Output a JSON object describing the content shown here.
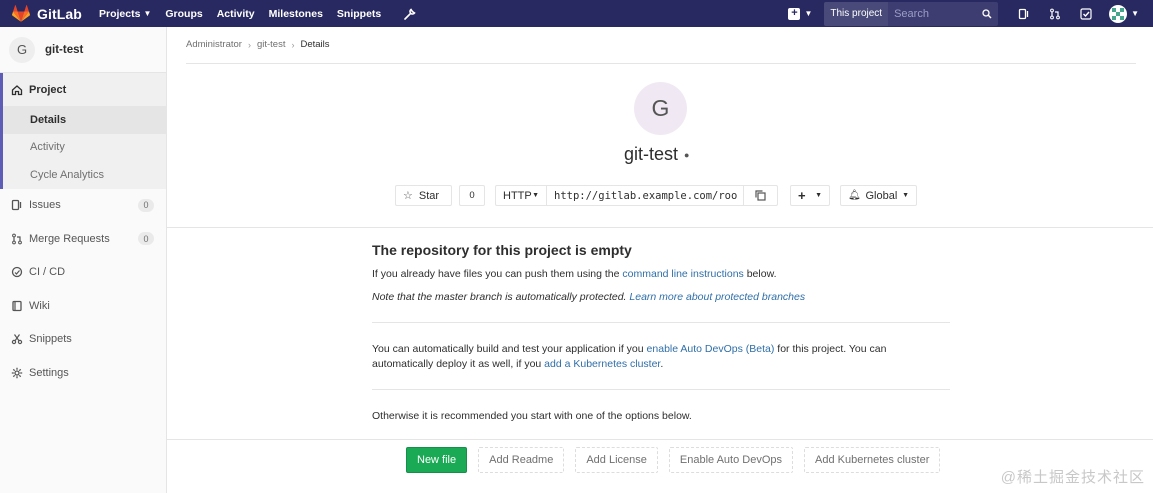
{
  "navbar": {
    "brand": "GitLab",
    "links": [
      {
        "label": "Projects",
        "dropdown": true
      },
      {
        "label": "Groups",
        "dropdown": false
      },
      {
        "label": "Activity",
        "dropdown": false
      },
      {
        "label": "Milestones",
        "dropdown": false
      },
      {
        "label": "Snippets",
        "dropdown": false
      }
    ],
    "search_scope": "This project",
    "search_placeholder": "Search",
    "bg_color": "#292961"
  },
  "sidebar": {
    "avatar_letter": "G",
    "project_name": "git-test",
    "project_label": "Project",
    "project_subitems": [
      {
        "label": "Details",
        "active": true
      },
      {
        "label": "Activity",
        "active": false
      },
      {
        "label": "Cycle Analytics",
        "active": false
      }
    ],
    "items": [
      {
        "label": "Issues",
        "icon": "issues-icon",
        "count": "0"
      },
      {
        "label": "Merge Requests",
        "icon": "merge-request-icon",
        "count": "0"
      },
      {
        "label": "CI / CD",
        "icon": "rocket-icon",
        "count": null
      },
      {
        "label": "Wiki",
        "icon": "book-icon",
        "count": null
      },
      {
        "label": "Snippets",
        "icon": "scissors-icon",
        "count": null
      },
      {
        "label": "Settings",
        "icon": "gear-icon",
        "count": null
      }
    ]
  },
  "breadcrumb": [
    "Administrator",
    "git-test",
    "Details"
  ],
  "project": {
    "avatar_letter": "G",
    "title": "git-test",
    "star_label": "Star",
    "star_count": "0",
    "protocol": "HTTP",
    "clone_url": "http://gitlab.example.com/roo",
    "notification": "Global"
  },
  "empty": {
    "title": "The repository for this project is empty",
    "line1_prefix": "If you already have files you can push them using the ",
    "line1_link": "command line instructions",
    "line1_suffix": " below.",
    "line2_prefix": "Note that the master branch is automatically protected. ",
    "line2_link": "Learn more about protected branches",
    "devops_prefix": "You can automatically build and test your application if you ",
    "devops_link": "enable Auto DevOps (Beta)",
    "devops_mid": " for this project. You can automatically deploy it as well, if you ",
    "devops_link2": "add a Kubernetes cluster",
    "devops_suffix": ".",
    "otherwise": "Otherwise it is recommended you start with one of the options below."
  },
  "actions": [
    "New file",
    "Add Readme",
    "Add License",
    "Enable Auto DevOps",
    "Add Kubernetes cluster"
  ],
  "watermark": "@稀土掘金技术社区"
}
